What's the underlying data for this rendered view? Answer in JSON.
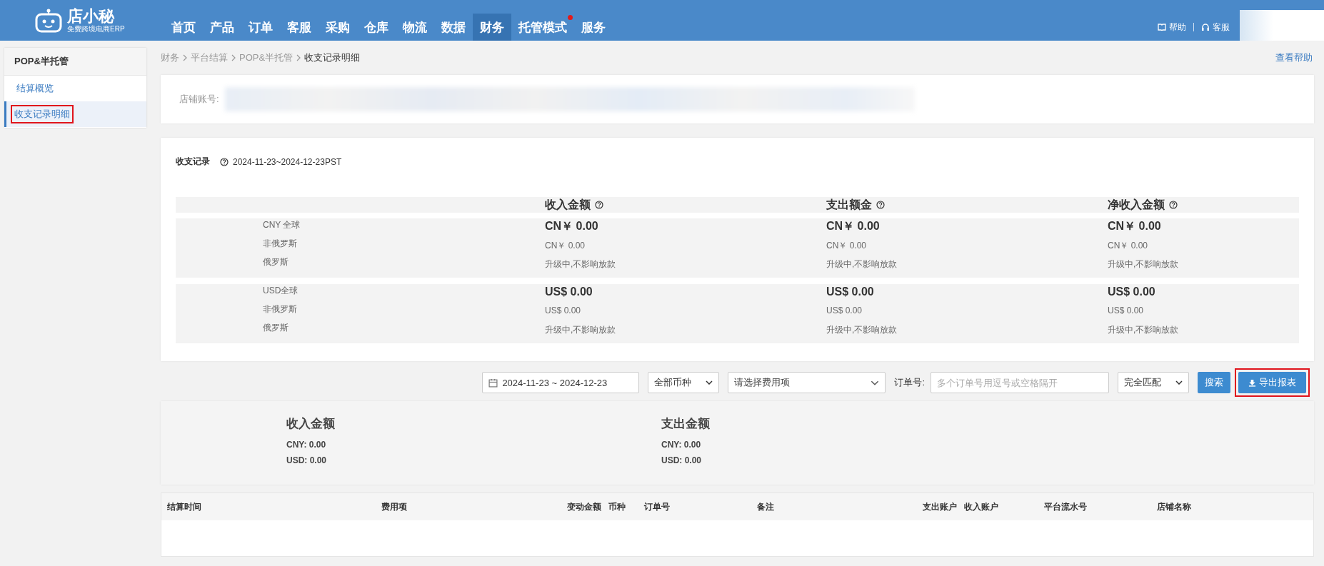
{
  "header": {
    "logo_text": "店小秘",
    "logo_subtitle": "免费跨境电商ERP",
    "nav": [
      {
        "label": "首页",
        "selected": false,
        "badge": false
      },
      {
        "label": "产品",
        "selected": false,
        "badge": false
      },
      {
        "label": "订单",
        "selected": false,
        "badge": false
      },
      {
        "label": "客服",
        "selected": false,
        "badge": false
      },
      {
        "label": "采购",
        "selected": false,
        "badge": false
      },
      {
        "label": "仓库",
        "selected": false,
        "badge": false
      },
      {
        "label": "物流",
        "selected": false,
        "badge": false
      },
      {
        "label": "数据",
        "selected": false,
        "badge": false
      },
      {
        "label": "财务",
        "selected": true,
        "badge": false
      },
      {
        "label": "托管模式",
        "selected": false,
        "badge": true
      },
      {
        "label": "服务",
        "selected": false,
        "badge": false
      }
    ],
    "help": "帮助",
    "service": "客服"
  },
  "sidebar": {
    "title": "POP&半托管",
    "items": [
      {
        "label": "结算概览",
        "selected": false,
        "highlighted": false
      },
      {
        "label": "收支记录明细",
        "selected": true,
        "highlighted": true
      }
    ]
  },
  "breadcrumb": [
    "财务",
    "平台结算",
    "POP&半托管",
    "收支记录明细"
  ],
  "help_link": "查看帮助",
  "store_account": {
    "label": "店铺账号:"
  },
  "records": {
    "title": "收支记录",
    "period": "2024-11-23~2024-12-23PST",
    "columns": [
      "收入金额",
      "支出额金",
      "净收入金额"
    ],
    "groups": [
      {
        "labels": [
          "CNY 全球",
          "非俄罗斯",
          "俄罗斯"
        ],
        "cells": [
          {
            "main": "CN￥ 0.00",
            "sub": "CN￥ 0.00",
            "note": "升级中,不影响放款"
          },
          {
            "main": "CN￥ 0.00",
            "sub": "CN￥ 0.00",
            "note": "升级中,不影响放款"
          },
          {
            "main": "CN￥ 0.00",
            "sub": "CN￥ 0.00",
            "note": "升级中,不影响放款"
          }
        ]
      },
      {
        "labels": [
          "USD全球",
          "非俄罗斯",
          "俄罗斯"
        ],
        "cells": [
          {
            "main": "US$ 0.00",
            "sub": "US$ 0.00",
            "note": "升级中,不影响放款"
          },
          {
            "main": "US$ 0.00",
            "sub": "US$ 0.00",
            "note": "升级中,不影响放款"
          },
          {
            "main": "US$ 0.00",
            "sub": "US$ 0.00",
            "note": "升级中,不影响放款"
          }
        ]
      }
    ]
  },
  "filters": {
    "date_range": "2024-11-23 ~ 2024-12-23",
    "currency": "全部币种",
    "fee_type_placeholder": "请选择费用项",
    "order_label": "订单号:",
    "order_placeholder": "多个订单号用逗号或空格隔开",
    "match": "完全匹配",
    "search_button": "搜索",
    "export_button": {
      "label": "导出报表",
      "highlighted": true
    }
  },
  "totals": [
    {
      "title": "收入金额",
      "lines": [
        "CNY: 0.00",
        "USD: 0.00"
      ]
    },
    {
      "title": "支出金额",
      "lines": [
        "CNY: 0.00",
        "USD: 0.00"
      ]
    }
  ],
  "table": {
    "columns": [
      "结算时间",
      "费用项",
      "变动金额",
      "币种",
      "订单号",
      "备注",
      "支出账户",
      "收入账户",
      "平台流水号",
      "店铺名称"
    ]
  }
}
